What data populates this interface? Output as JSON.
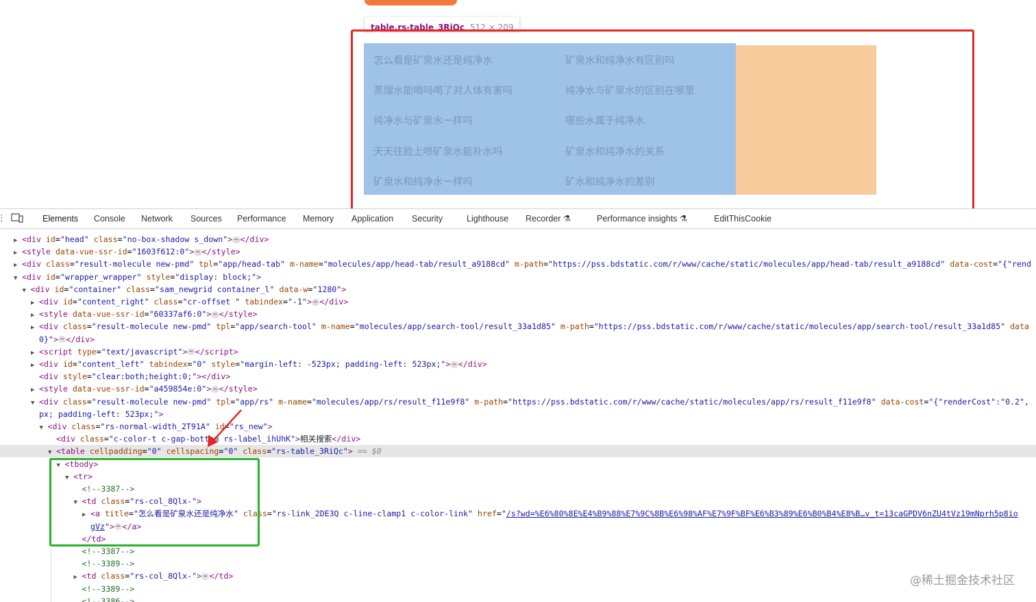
{
  "tooltip": {
    "selector": "table.rs-table_3RiQc",
    "size": "512 × 209"
  },
  "related": [
    "怎么看是矿泉水还是纯净水",
    "矿泉水和纯净水有区别吗",
    "蒸馏水能喝吗喝了对人体有害吗",
    "纯净水与矿泉水的区别在哪里",
    "纯净水与矿泉水一样吗",
    "哪些水属于纯净水",
    "天天往脸上喷矿泉水能补水吗",
    "矿泉水和纯净水的关系",
    "矿泉水和纯净水一样吗",
    "矿水和纯净水的差别"
  ],
  "devtools": {
    "tabs": [
      "Elements",
      "Console",
      "Network",
      "Sources",
      "Performance",
      "Memory",
      "Application",
      "Security",
      "Lighthouse",
      "Recorder ⚗",
      "Performance insights ⚗",
      "EditThisCookie"
    ],
    "active_tab": "Elements"
  },
  "dom_lines": [
    {
      "ind": 0,
      "tri": "▶",
      "h": "<span class='t'>&lt;div</span> <span class='a'>id</span>=<span class='v'>\"head\"</span> <span class='a'>class</span>=<span class='v'>\"no-box-shadow s_down\"</span><span class='t'>&gt;</span><span class='ell'>⋯</span><span class='t'>&lt;/div&gt;</span>"
    },
    {
      "ind": 0,
      "tri": "▶",
      "h": "<span class='t'>&lt;style</span> <span class='a'>data-vue-ssr-id</span>=<span class='v'>\"1603f612:0\"</span><span class='t'>&gt;</span><span class='ell'>⋯</span><span class='t'>&lt;/style&gt;</span>"
    },
    {
      "ind": 0,
      "tri": "▶",
      "h": "<span class='t'>&lt;div</span> <span class='a'>class</span>=<span class='v'>\"result-molecule  new-pmd\"</span> <span class='a'>tpl</span>=<span class='v'>\"app/head-tab\"</span> <span class='a'>m-name</span>=<span class='v'>\"molecules/app/head-tab/result_a9188cd\"</span> <span class='a'>m-path</span>=<span class='v'>\"https://pss.bdstatic.com/r/www/cache/static/molecules/app/head-tab/result_a9188cd\"</span> <span class='a'>data-cost</span>=<span class='v'>\"{\"rend</span>"
    },
    {
      "ind": 0,
      "tri": "▼",
      "h": "<span class='t'>&lt;div</span> <span class='a'>id</span>=<span class='v'>\"wrapper_wrapper\"</span> <span class='a'>style</span>=<span class='v'>\"display: block;\"</span><span class='t'>&gt;</span>"
    },
    {
      "ind": 1,
      "tri": "▼",
      "h": "<span class='t'>&lt;div</span> <span class='a'>id</span>=<span class='v'>\"container\"</span> <span class='a'>class</span>=<span class='v'>\"sam_newgrid container_l\"</span> <span class='a'>data-w</span>=<span class='v'>\"1280\"</span><span class='t'>&gt;</span>"
    },
    {
      "ind": 2,
      "tri": "▶",
      "h": "<span class='t'>&lt;div</span> <span class='a'>id</span>=<span class='v'>\"content_right\"</span> <span class='a'>class</span>=<span class='v'>\"cr-offset \"</span> <span class='a'>tabindex</span>=<span class='v'>\"-1\"</span><span class='t'>&gt;</span><span class='ell'>⋯</span><span class='t'>&lt;/div&gt;</span>"
    },
    {
      "ind": 2,
      "tri": "▶",
      "h": "<span class='t'>&lt;style</span> <span class='a'>data-vue-ssr-id</span>=<span class='v'>\"60337af6:0\"</span><span class='t'>&gt;</span><span class='ell'>⋯</span><span class='t'>&lt;/style&gt;</span>"
    },
    {
      "ind": 2,
      "tri": "▶",
      "h": "<span class='t'>&lt;div</span> <span class='a'>class</span>=<span class='v'>\"result-molecule  new-pmd\"</span> <span class='a'>tpl</span>=<span class='v'>\"app/search-tool\"</span> <span class='a'>m-name</span>=<span class='v'>\"molecules/app/search-tool/result_33a1d85\"</span> <span class='a'>m-path</span>=<span class='v'>\"https://pss.bdstatic.com/r/www/cache/static/molecules/app/search-tool/result_33a1d85\"</span> <span class='a'>data</span>"
    },
    {
      "ind": 2,
      "tri": "",
      "h": "<span class='v'>0}\"</span><span class='t'>&gt;</span><span class='ell'>⋯</span><span class='t'>&lt;/div&gt;</span>"
    },
    {
      "ind": 2,
      "tri": "▶",
      "h": "<span class='t'>&lt;script</span> <span class='a'>type</span>=<span class='v'>\"text/javascript\"</span><span class='t'>&gt;</span><span class='ell'>⋯</span><span class='t'>&lt;/script&gt;</span>"
    },
    {
      "ind": 2,
      "tri": "▶",
      "h": "<span class='t'>&lt;div</span> <span class='a'>id</span>=<span class='v'>\"content_left\"</span> <span class='a'>tabindex</span>=<span class='v'>\"0\"</span> <span class='a'>style</span>=<span class='v'>\"margin-left: -523px; padding-left: 523px;\"</span><span class='t'>&gt;</span><span class='ell'>⋯</span><span class='t'>&lt;/div&gt;</span>"
    },
    {
      "ind": 2,
      "tri": "",
      "h": "<span class='t'>&lt;div</span> <span class='a'>style</span>=<span class='v'>\"clear:both;height:0;\"</span><span class='t'>&gt;&lt;/div&gt;</span>"
    },
    {
      "ind": 2,
      "tri": "▶",
      "h": "<span class='t'>&lt;style</span> <span class='a'>data-vue-ssr-id</span>=<span class='v'>\"a459854e:0\"</span><span class='t'>&gt;</span><span class='ell'>⋯</span><span class='t'>&lt;/style&gt;</span>"
    },
    {
      "ind": 2,
      "tri": "▼",
      "h": "<span class='t'>&lt;div</span> <span class='a'>class</span>=<span class='v'>\"result-molecule  new-pmd\"</span> <span class='a'>tpl</span>=<span class='v'>\"app/rs\"</span> <span class='a'>m-name</span>=<span class='v'>\"molecules/app/rs/result_f11e9f8\"</span> <span class='a'>m-path</span>=<span class='v'>\"https://pss.bdstatic.com/r/www/cache/static/molecules/app/rs/result_f11e9f8\"</span> <span class='a'>data-cost</span>=<span class='v'>\"{\"renderCost\":\"0.2\",</span>"
    },
    {
      "ind": 2,
      "tri": "",
      "h": "<span class='v'>px; padding-left: 523px;\"</span><span class='t'>&gt;</span>"
    },
    {
      "ind": 3,
      "tri": "▼",
      "h": "<span class='t'>&lt;div</span> <span class='a'>class</span>=<span class='v'>\"rs-normal-width_2T91A\"</span> <span class='a'>id</span>=<span class='v'>\"rs_new\"</span><span class='t'>&gt;</span>"
    },
    {
      "ind": 4,
      "tri": "",
      "h": "<span class='t'>&lt;div</span> <span class='a'>class</span>=<span class='v'>\"c-color-t c-gap-bottom rs-label_ihUhK\"</span><span class='t'>&gt;</span><span class='x'>相关搜索</span><span class='t'>&lt;/div&gt;</span>"
    },
    {
      "ind": 4,
      "tri": "▼",
      "sel": true,
      "h": "<span class='t'>&lt;table</span> <span class='a'>cellpadding</span>=<span class='v'>\"0\"</span> <span class='a'>cellspacing</span>=<span class='v'>\"0\"</span> <span class='a'>class</span>=<span class='v'>\"rs-table_3RiQc\"</span><span class='t'>&gt;</span> <span class='eq'>== $0</span>"
    },
    {
      "ind": 5,
      "tri": "▼",
      "h": "<span class='t'>&lt;tbody&gt;</span>"
    },
    {
      "ind": 6,
      "tri": "▼",
      "h": "<span class='t'>&lt;tr&gt;</span>"
    },
    {
      "ind": 7,
      "tri": "",
      "h": "<span class='c'>&lt;!--3387--&gt;</span>"
    },
    {
      "ind": 7,
      "tri": "▼",
      "h": "<span class='t'>&lt;td</span> <span class='a'>class</span>=<span class='v'>\"rs-col_8Qlx-\"</span><span class='t'>&gt;</span>"
    },
    {
      "ind": 8,
      "tri": "▶",
      "h": "<span class='t'>&lt;a</span> <span class='a'>title</span>=<span class='v'>\"怎么看是矿泉水还是纯净水\"</span> <span class='a'>class</span>=<span class='v'>\"rs-link_2DE3Q c-line-clamp1 c-color-link\"</span> <span class='a'>href</span>=<span class='v'>\"</span><span class='lnk'>/s?wd=%E6%80%8E%E4%B9%88%E7%9C%8B%E6%98%AF%E7%9F%BF%E6%B3%89%E6%B0%B4%E8%B…v_t=13caGPDV6nZU4tVz19mNprh5p8io</span>"
    },
    {
      "ind": 8,
      "tri": "",
      "h": "<span class='lnk'>gVz</span><span class='v'>\"</span><span class='t'>&gt;</span><span class='ell'>⋯</span><span class='t'>&lt;/a&gt;</span>"
    },
    {
      "ind": 7,
      "tri": "",
      "h": "<span class='t'>&lt;/td&gt;</span>"
    },
    {
      "ind": 7,
      "tri": "",
      "h": "<span class='c'>&lt;!--3387--&gt;</span>"
    },
    {
      "ind": 7,
      "tri": "",
      "h": "<span class='c'>&lt;!--3389--&gt;</span>"
    },
    {
      "ind": 7,
      "tri": "▶",
      "h": "<span class='t'>&lt;td</span> <span class='a'>class</span>=<span class='v'>\"rs-col_8Qlx-\"</span><span class='t'>&gt;</span><span class='ell'>⋯</span><span class='t'>&lt;/td&gt;</span>"
    },
    {
      "ind": 7,
      "tri": "",
      "h": "<span class='c'>&lt;!--3389--&gt;</span>"
    },
    {
      "ind": 7,
      "tri": "",
      "h": "<span class='c'>&lt;!--3386--&gt;</span>"
    }
  ],
  "watermark": "@稀土掘金技术社区"
}
